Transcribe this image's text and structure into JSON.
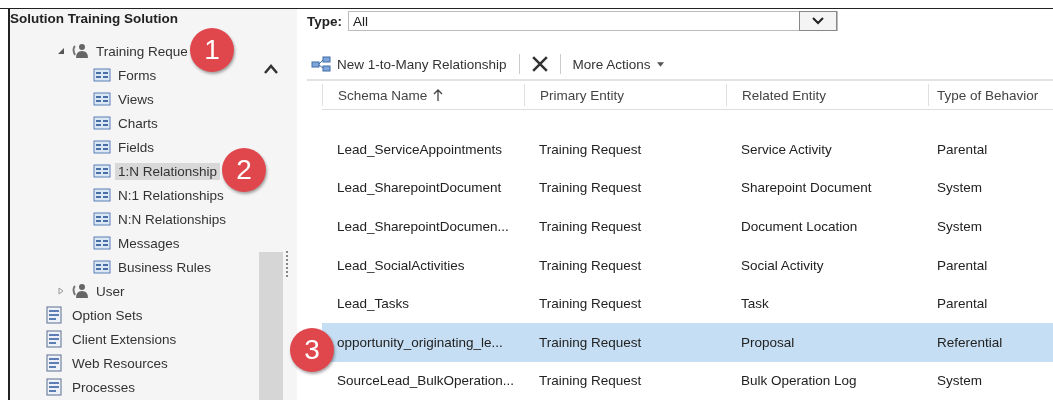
{
  "sidebar": {
    "title": "Solution Training Solution",
    "entities": [
      {
        "label": "Training Reque",
        "expanded": true,
        "children": [
          {
            "label": "Forms",
            "selected": false
          },
          {
            "label": "Views",
            "selected": false
          },
          {
            "label": "Charts",
            "selected": false
          },
          {
            "label": "Fields",
            "selected": false
          },
          {
            "label": "1:N Relationship",
            "selected": true
          },
          {
            "label": "N:1 Relationships",
            "selected": false
          },
          {
            "label": "N:N Relationships",
            "selected": false
          },
          {
            "label": "Messages",
            "selected": false
          },
          {
            "label": "Business Rules",
            "selected": false
          }
        ]
      },
      {
        "label": "User",
        "expanded": false
      }
    ],
    "components": [
      {
        "label": "Option Sets"
      },
      {
        "label": "Client Extensions"
      },
      {
        "label": "Web Resources"
      },
      {
        "label": "Processes"
      }
    ]
  },
  "filter": {
    "label": "Type:",
    "value": "All"
  },
  "toolbar": {
    "new_button": "New 1-to-Many Relationship",
    "more_actions": "More Actions"
  },
  "table": {
    "columns": [
      {
        "label": "Schema Name",
        "sorted": true
      },
      {
        "label": "Primary Entity",
        "sorted": false
      },
      {
        "label": "Related Entity",
        "sorted": false
      },
      {
        "label": "Type of Behavior",
        "sorted": false
      }
    ],
    "rows": [
      {
        "cells": [
          "Lead_ServiceAppointments",
          "Training Request",
          "Service Activity",
          "Parental"
        ],
        "selected": false
      },
      {
        "cells": [
          "Lead_SharepointDocument",
          "Training Request",
          "Sharepoint Document",
          "System"
        ],
        "selected": false
      },
      {
        "cells": [
          "Lead_SharepointDocumen...",
          "Training Request",
          "Document Location",
          "System"
        ],
        "selected": false
      },
      {
        "cells": [
          "Lead_SocialActivities",
          "Training Request",
          "Social Activity",
          "Parental"
        ],
        "selected": false
      },
      {
        "cells": [
          "Lead_Tasks",
          "Training Request",
          "Task",
          "Parental"
        ],
        "selected": false
      },
      {
        "cells": [
          "opportunity_originating_le...",
          "Training Request",
          "Proposal",
          "Referential"
        ],
        "selected": true
      },
      {
        "cells": [
          "SourceLead_BulkOperation...",
          "Training Request",
          "Bulk Operation Log",
          "System"
        ],
        "selected": false
      }
    ]
  },
  "callouts": [
    "1",
    "2",
    "3"
  ]
}
